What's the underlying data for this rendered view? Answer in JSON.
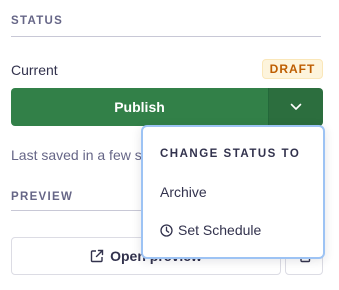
{
  "status_section": {
    "title": "STATUS",
    "current_label": "Current",
    "badge": "DRAFT"
  },
  "publish": {
    "label": "Publish",
    "toggle_icon": "chevron-down-icon"
  },
  "last_saved": "Last saved in a few seconds",
  "preview_section": {
    "title": "PREVIEW",
    "open_preview_label": "Open preview",
    "open_preview_icon": "external-link-icon",
    "copy_icon": "copy-icon"
  },
  "status_menu": {
    "heading": "CHANGE STATUS TO",
    "items": [
      {
        "label": "Archive"
      },
      {
        "label": "Set Schedule",
        "icon": "clock-icon"
      }
    ]
  },
  "colors": {
    "publish_green": "#328048",
    "publish_toggle_green": "#2c6e3e",
    "draft_badge_bg": "#fdf4dc",
    "draft_badge_text": "#be5d01",
    "menu_focus_border": "#9dc3f4"
  }
}
